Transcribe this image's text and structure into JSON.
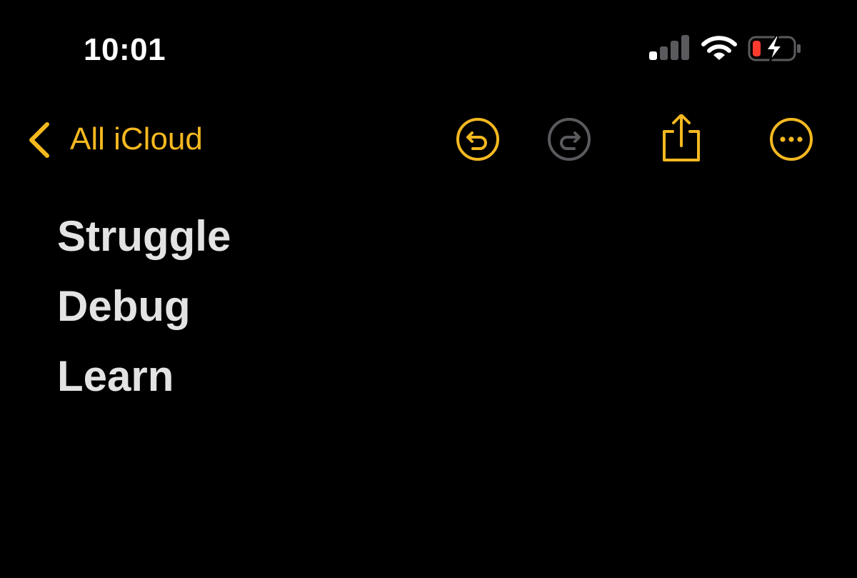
{
  "status_bar": {
    "time": "10:01",
    "signal_bars_active": 1,
    "signal_bars_total": 4,
    "wifi_icon": "wifi-icon",
    "battery_state": "charging-low",
    "battery_level_fraction": 0.15
  },
  "colors": {
    "accent": "#f4b820",
    "accent_disabled": "#5a5a5e",
    "background": "#000000",
    "text": "#e3e3e3",
    "battery_low": "#ff3b30"
  },
  "nav": {
    "back_label": "All iCloud",
    "back_icon": "chevron-left-icon",
    "undo_icon": "undo-icon",
    "undo_enabled": true,
    "redo_icon": "redo-icon",
    "redo_enabled": false,
    "share_icon": "share-icon",
    "more_icon": "ellipsis-circle-icon"
  },
  "note": {
    "lines": [
      "Struggle",
      "Debug",
      "Learn"
    ]
  }
}
